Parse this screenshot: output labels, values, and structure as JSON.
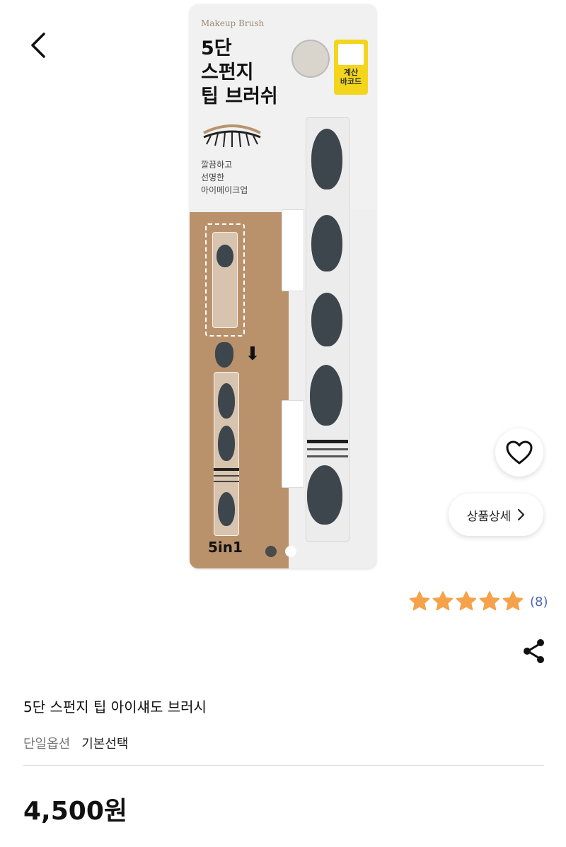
{
  "nav": {
    "back_icon": "chevron-left-icon"
  },
  "product_image": {
    "brand": "Makeup Brush",
    "title": "5단\n스펀지\n팁 브러쉬",
    "tagline": "깔끔하고\n선명한\n아이메이크업",
    "badge": "계산\n바코드",
    "pack_label": "5in1"
  },
  "carousel": {
    "total": 2,
    "active_index": 0
  },
  "actions": {
    "wish_icon": "heart-outline-icon",
    "detail_label": "상품상세",
    "detail_icon": "chevron-right-icon",
    "share_icon": "share-icon"
  },
  "rating": {
    "stars": 5,
    "max": 5,
    "review_count": "(8)",
    "star_color": "#f5a24a"
  },
  "product": {
    "name": "5단 스펀지 팁 아이섀도 브러시",
    "option_label": "단일옵션",
    "option_value": "기본선택",
    "price": "4,500원"
  }
}
